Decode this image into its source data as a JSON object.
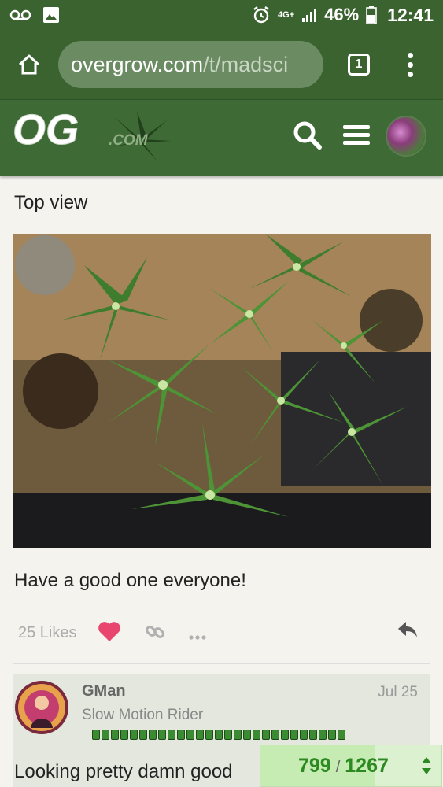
{
  "status_bar": {
    "network": "4G+",
    "battery": "46%",
    "time": "12:41"
  },
  "browser": {
    "url_host": "overgrow.com",
    "url_path": "/t/madsci",
    "tab_count": "1"
  },
  "site": {
    "logo_text": "OG",
    "logo_suffix": ".COM"
  },
  "post": {
    "text_top": "Top view",
    "text_bottom": "Have a good one everyone!",
    "likes_label": "25 Likes",
    "like_color": "#e8456f"
  },
  "reply": {
    "username": "GMan",
    "date": "Jul 25",
    "user_title": "Slow Motion Rider",
    "trust_dots": 27,
    "text": "Looking pretty damn good"
  },
  "progress": {
    "current": "799",
    "total": "1267",
    "fraction": 0.631
  }
}
